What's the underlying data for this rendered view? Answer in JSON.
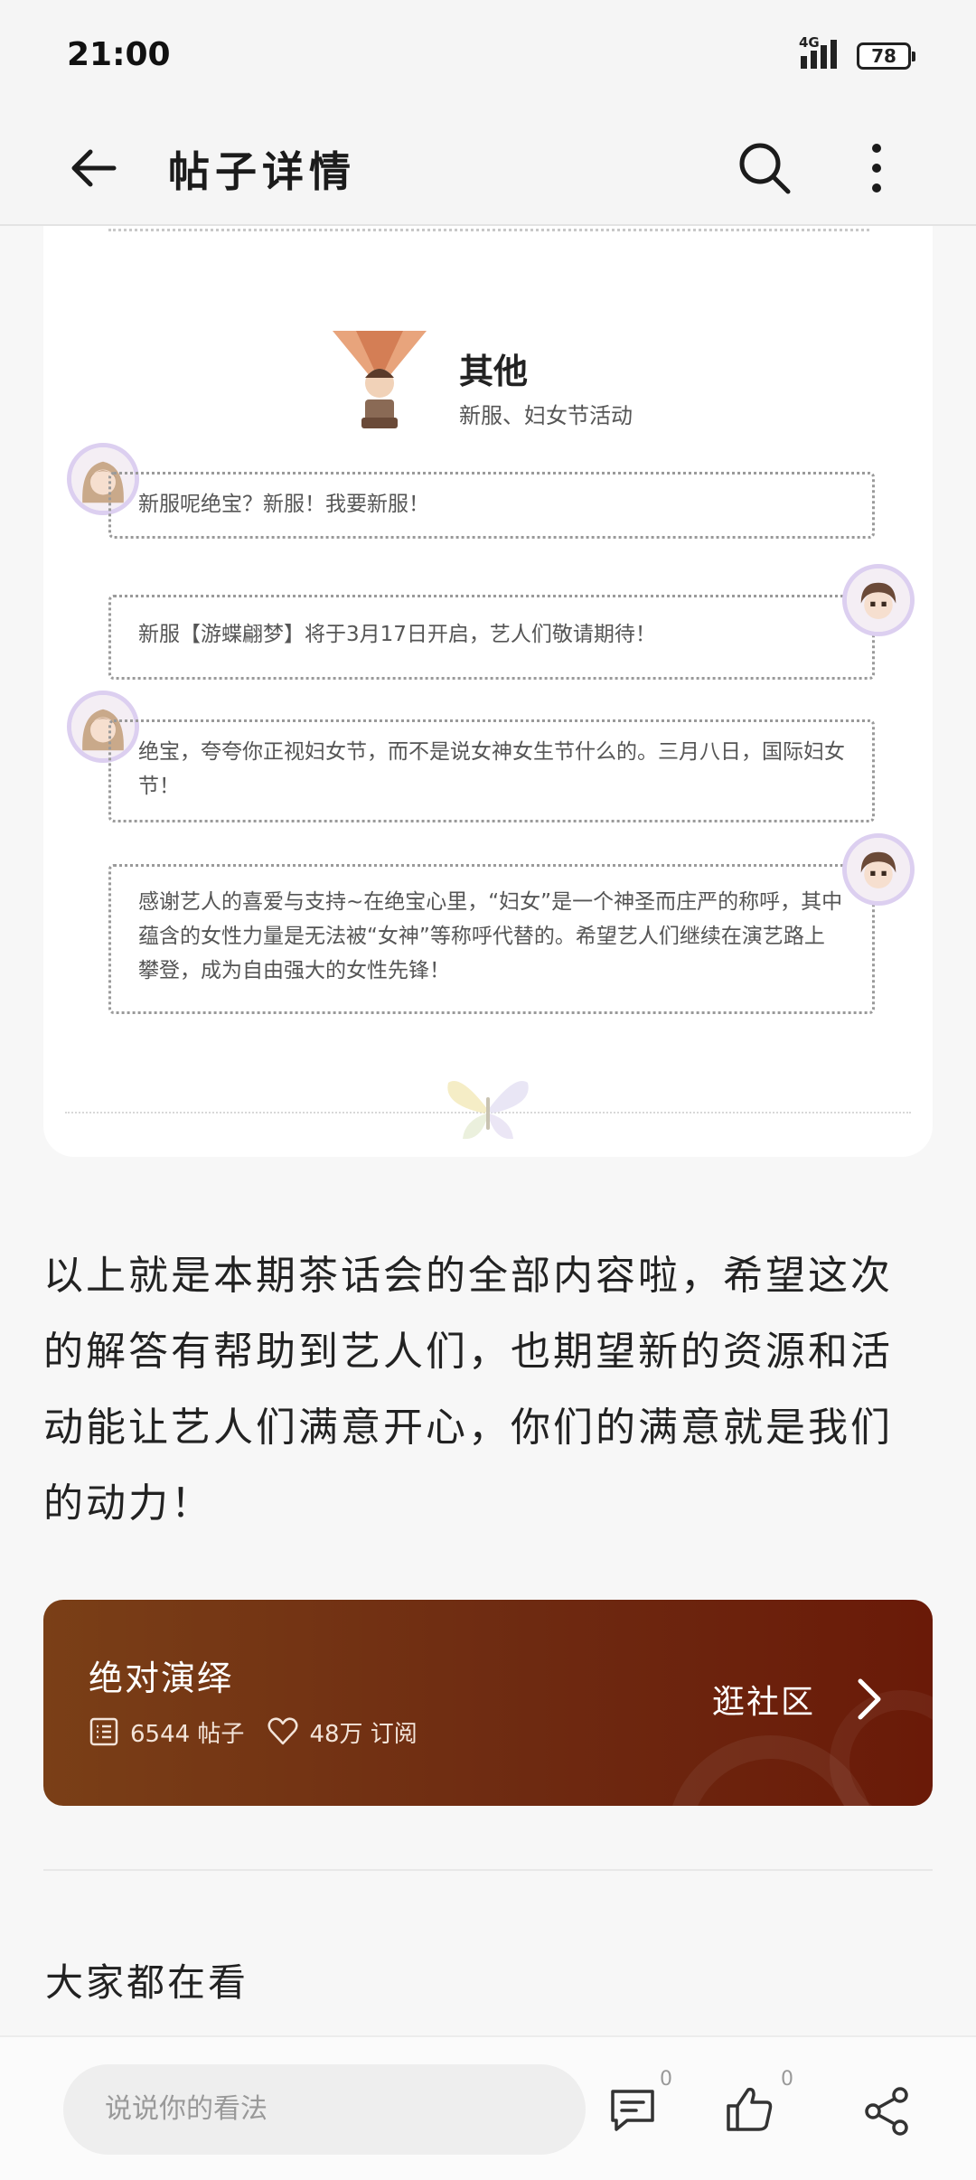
{
  "status": {
    "time": "21:00",
    "network": "4G",
    "battery": "78"
  },
  "header": {
    "title": "帖子详情"
  },
  "card": {
    "section_title": "其他",
    "section_subtitle": "新服、妇女节活动",
    "bubbles": [
      {
        "text": "新服呢绝宝？新服！我要新服！",
        "side": "left"
      },
      {
        "text": "新服【游蝶翩梦】将于3月17日开启，艺人们敬请期待！",
        "side": "right"
      },
      {
        "text": "绝宝，夸夸你正视妇女节，而不是说女神女生节什么的。三月八日，国际妇女节！",
        "side": "left"
      },
      {
        "text": "感谢艺人的喜爱与支持~在绝宝心里，“妇女”是一个神圣而庄严的称呼，其中蕴含的女性力量是无法被“女神”等称呼代替的。希望艺人们继续在演艺路上攀登，成为自由强大的女性先锋！",
        "side": "right"
      }
    ]
  },
  "post": {
    "paragraph": "以上就是本期茶话会的全部内容啦，希望这次的解答有帮助到艺人们，也期望新的资源和活动能让艺人们满意开心，你们的满意就是我们的动力！"
  },
  "community": {
    "name": "绝对演绎",
    "posts": "6544 帖子",
    "subscribers": "48万 订阅",
    "action": "逛社区"
  },
  "recommend": {
    "title": "大家都在看"
  },
  "bottom": {
    "placeholder": "说说你的看法",
    "comment_count": "0",
    "like_count": "0"
  }
}
